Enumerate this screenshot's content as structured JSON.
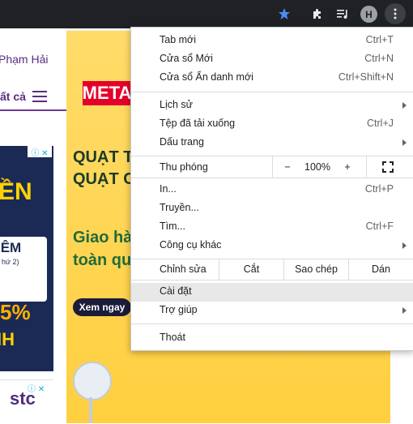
{
  "toolbar": {
    "avatar_initial": "H",
    "star_color": "#4c8bf5"
  },
  "page": {
    "user_name": "Phạm Hải",
    "category_label": "ất cả",
    "ad1": {
      "adchoice": "ⓘ ✕",
      "headline": "ỀN",
      "box_title": "IÊM",
      "box_sub": "hứ 2)",
      "percent": "5%",
      "bottom": "IH"
    },
    "ad2": {
      "brand": "stc",
      "adchoice": "ⓘ ✕"
    },
    "banner": {
      "logo": "META",
      "line1": "QUẠT TR",
      "line2": "QUẠT CÂ",
      "line3": "Giao hà",
      "line4": "toàn qu",
      "cta": "Xem ngay"
    }
  },
  "menu": {
    "new_tab": {
      "label": "Tab mới",
      "shortcut": "Ctrl+T"
    },
    "new_window": {
      "label": "Cửa sổ Mới",
      "shortcut": "Ctrl+N"
    },
    "incognito": {
      "label": "Cửa sổ Ẩn danh mới",
      "shortcut": "Ctrl+Shift+N"
    },
    "history": {
      "label": "Lịch sử"
    },
    "downloads": {
      "label": "Tệp đã tải xuống",
      "shortcut": "Ctrl+J"
    },
    "bookmarks": {
      "label": "Dấu trang"
    },
    "zoom": {
      "label": "Thu phóng",
      "minus": "−",
      "level": "100%",
      "plus": "+"
    },
    "print": {
      "label": "In...",
      "shortcut": "Ctrl+P"
    },
    "cast": {
      "label": "Truyền..."
    },
    "find": {
      "label": "Tìm...",
      "shortcut": "Ctrl+F"
    },
    "more_tools": {
      "label": "Công cụ khác"
    },
    "edit": {
      "label": "Chỉnh sửa",
      "cut": "Cắt",
      "copy": "Sao chép",
      "paste": "Dán"
    },
    "settings": {
      "label": "Cài đặt"
    },
    "help": {
      "label": "Trợ giúp"
    },
    "exit": {
      "label": "Thoát"
    }
  }
}
